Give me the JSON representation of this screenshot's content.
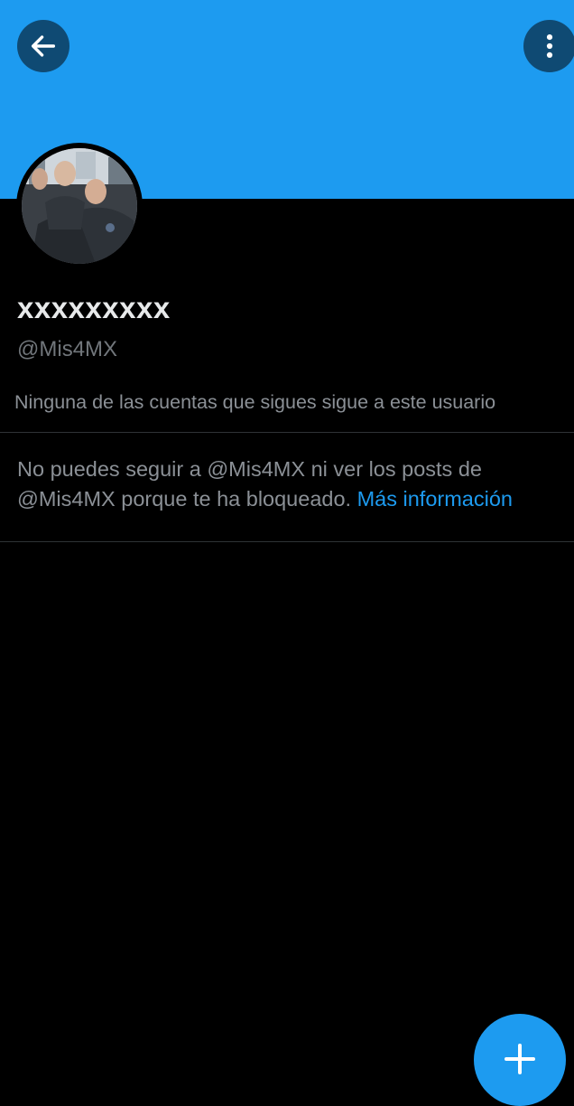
{
  "header": {
    "back_icon": "arrow-left-icon",
    "more_icon": "more-vertical-icon",
    "banner_color": "#1d9bf0"
  },
  "profile": {
    "display_name": "xxxxxxxxx",
    "handle": "@Mis4MX",
    "followers_you_know": "Ninguna de las cuentas que sigues sigue a este usuario"
  },
  "blocked_notice": {
    "message": "No puedes seguir a @Mis4MX ni ver los posts de @Mis4MX porque te ha bloqueado. ",
    "link_label": "Más información",
    "link_color": "#1d9bf0"
  },
  "fab": {
    "icon": "plus-icon",
    "color": "#1d9bf0"
  }
}
